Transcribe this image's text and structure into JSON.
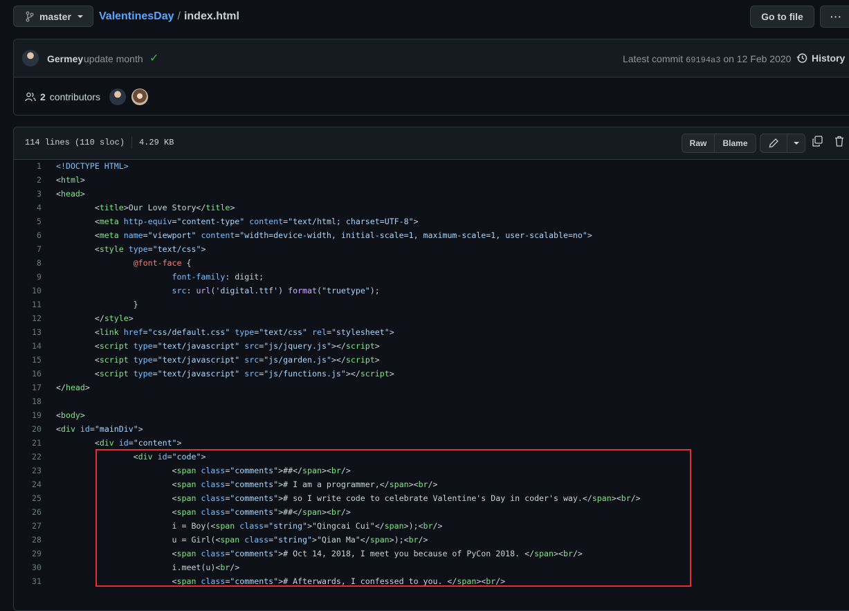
{
  "topbar": {
    "branch": "master",
    "repo": "ValentinesDay",
    "separator": "/",
    "file": "index.html",
    "goto_label": "Go to file",
    "more_label": "···"
  },
  "commit": {
    "author": "Germey",
    "message": "update month",
    "latest_prefix": "Latest commit",
    "sha": "69194a3",
    "date_text": "on 12 Feb 2020",
    "history_label": "History",
    "contributors_count": "2",
    "contributors_label": "contributors"
  },
  "file": {
    "lines_info": "114 lines (110 sloc)",
    "size": "4.29 KB",
    "raw_label": "Raw",
    "blame_label": "Blame"
  },
  "code_lines": [
    {
      "n": "1",
      "html": "<span class='attr'>&lt;!DOCTYPE HTML&gt;</span>"
    },
    {
      "n": "2",
      "html": "&lt;<span class='tag'>html</span>&gt;"
    },
    {
      "n": "3",
      "html": "&lt;<span class='tag'>head</span>&gt;"
    },
    {
      "n": "4",
      "html": "        &lt;<span class='tag'>title</span>&gt;Our Love Story&lt;/<span class='tag'>title</span>&gt;"
    },
    {
      "n": "5",
      "html": "        &lt;<span class='tag'>meta</span> <span class='attr'>http-equiv</span>=<span class='str'>\"content-type\"</span> <span class='attr'>content</span>=<span class='str'>\"text/html; charset=UTF-8\"</span>&gt;"
    },
    {
      "n": "6",
      "html": "        &lt;<span class='tag'>meta</span> <span class='attr'>name</span>=<span class='str'>\"viewport\"</span> <span class='attr'>content</span>=<span class='str'>\"width=device-width, initial-scale=1, maximum-scale=1, user-scalable=no\"</span>&gt;"
    },
    {
      "n": "7",
      "html": "        &lt;<span class='tag'>style</span> <span class='attr'>type</span>=<span class='str'>\"text/css\"</span>&gt;"
    },
    {
      "n": "8",
      "html": "                <span class='kw'>@font-face</span> {"
    },
    {
      "n": "9",
      "html": "                        <span class='attr'>font-family</span>: digit;"
    },
    {
      "n": "10",
      "html": "                        <span class='attr'>src</span>: <span class='fn'>url</span>(<span class='str'>'digital.ttf'</span>) <span class='fn'>format</span>(<span class='str'>\"truetype\"</span>);"
    },
    {
      "n": "11",
      "html": "                }"
    },
    {
      "n": "12",
      "html": "        &lt;/<span class='tag'>style</span>&gt;"
    },
    {
      "n": "13",
      "html": "        &lt;<span class='tag'>link</span> <span class='attr'>href</span>=<span class='str'>\"css/default.css\"</span> <span class='attr'>type</span>=<span class='str'>\"text/css\"</span> <span class='attr'>rel</span>=<span class='str'>\"stylesheet\"</span>&gt;"
    },
    {
      "n": "14",
      "html": "        &lt;<span class='tag'>script</span> <span class='attr'>type</span>=<span class='str'>\"text/javascript\"</span> <span class='attr'>src</span>=<span class='str'>\"js/jquery.js\"</span>&gt;&lt;/<span class='tag'>script</span>&gt;"
    },
    {
      "n": "15",
      "html": "        &lt;<span class='tag'>script</span> <span class='attr'>type</span>=<span class='str'>\"text/javascript\"</span> <span class='attr'>src</span>=<span class='str'>\"js/garden.js\"</span>&gt;&lt;/<span class='tag'>script</span>&gt;"
    },
    {
      "n": "16",
      "html": "        &lt;<span class='tag'>script</span> <span class='attr'>type</span>=<span class='str'>\"text/javascript\"</span> <span class='attr'>src</span>=<span class='str'>\"js/functions.js\"</span>&gt;&lt;/<span class='tag'>script</span>&gt;"
    },
    {
      "n": "17",
      "html": "&lt;/<span class='tag'>head</span>&gt;"
    },
    {
      "n": "18",
      "html": ""
    },
    {
      "n": "19",
      "html": "&lt;<span class='tag'>body</span>&gt;"
    },
    {
      "n": "20",
      "html": "&lt;<span class='tag'>div</span> <span class='attr'>id</span>=<span class='str'>\"mainDiv\"</span>&gt;"
    },
    {
      "n": "21",
      "html": "        &lt;<span class='tag'>div</span> <span class='attr'>id</span>=<span class='str'>\"content\"</span>&gt;"
    },
    {
      "n": "22",
      "html": "                &lt;<span class='tag'>div</span> <span class='attr'>id</span>=<span class='str'>\"code\"</span>&gt;"
    },
    {
      "n": "23",
      "html": "                        &lt;<span class='tag'>span</span> <span class='attr'>class</span>=<span class='str'>\"comments\"</span>&gt;##&lt;/<span class='tag'>span</span>&gt;&lt;<span class='tag'>br</span>/&gt;"
    },
    {
      "n": "24",
      "html": "                        &lt;<span class='tag'>span</span> <span class='attr'>class</span>=<span class='str'>\"comments\"</span>&gt;# I am a programmer,&lt;/<span class='tag'>span</span>&gt;&lt;<span class='tag'>br</span>/&gt;"
    },
    {
      "n": "25",
      "html": "                        &lt;<span class='tag'>span</span> <span class='attr'>class</span>=<span class='str'>\"comments\"</span>&gt;# so I write code to celebrate Valentine's Day in coder's way.&lt;/<span class='tag'>span</span>&gt;&lt;<span class='tag'>br</span>/&gt;"
    },
    {
      "n": "26",
      "html": "                        &lt;<span class='tag'>span</span> <span class='attr'>class</span>=<span class='str'>\"comments\"</span>&gt;##&lt;/<span class='tag'>span</span>&gt;&lt;<span class='tag'>br</span>/&gt;"
    },
    {
      "n": "27",
      "html": "                        i = Boy(&lt;<span class='tag'>span</span> <span class='attr'>class</span>=<span class='str'>\"string\"</span>&gt;\"Qingcai Cui\"&lt;/<span class='tag'>span</span>&gt;);&lt;<span class='tag'>br</span>/&gt;"
    },
    {
      "n": "28",
      "html": "                        u = Girl(&lt;<span class='tag'>span</span> <span class='attr'>class</span>=<span class='str'>\"string\"</span>&gt;\"Qian Ma\"&lt;/<span class='tag'>span</span>&gt;);&lt;<span class='tag'>br</span>/&gt;"
    },
    {
      "n": "29",
      "html": "                        &lt;<span class='tag'>span</span> <span class='attr'>class</span>=<span class='str'>\"comments\"</span>&gt;# Oct 14, 2018, I meet you because of PyCon 2018. &lt;/<span class='tag'>span</span>&gt;&lt;<span class='tag'>br</span>/&gt;"
    },
    {
      "n": "30",
      "html": "                        i.meet(u)&lt;<span class='tag'>br</span>/&gt;"
    },
    {
      "n": "31",
      "html": "                        &lt;<span class='tag'>span</span> <span class='attr'>class</span>=<span class='str'>\"comments\"</span>&gt;# Afterwards, I confessed to you. &lt;/<span class='tag'>span</span>&gt;&lt;<span class='tag'>br</span>/&gt;"
    }
  ],
  "colors": {
    "background": "#0d1117",
    "link": "#58a6ff",
    "tag": "#7ee787",
    "attr": "#79c0ff",
    "string": "#a5d6ff",
    "highlight_box": "#e5302f",
    "check": "#3fb950"
  },
  "icons": [
    "branch-icon",
    "check-icon",
    "history-icon",
    "people-icon",
    "pencil-icon",
    "copy-icon",
    "trash-icon"
  ]
}
